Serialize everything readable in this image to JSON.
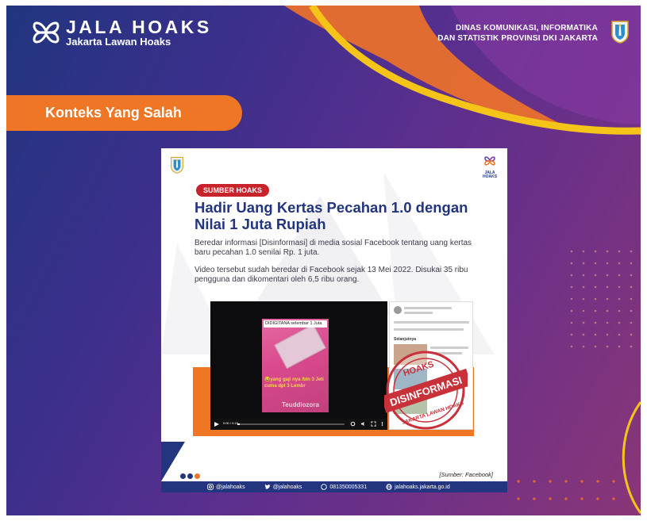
{
  "brand": {
    "title": "JALA HOAKS",
    "subtitle": "Jakarta Lawan Hoaks",
    "logo_icon": "jala-hoaks-logo-icon"
  },
  "agency": {
    "line1": "DINAS KOMUNIKASI, INFORMATIKA",
    "line2": "DAN STATISTIK PROVINSI DKI JAKARTA",
    "crest_icon": "dki-jakarta-crest-icon"
  },
  "category": "Konteks Yang Salah",
  "card": {
    "badge": "SUMBER HOAKS",
    "title": "Hadir Uang Kertas Pecahan 1.0 dengan Nilai 1 Juta Rupiah",
    "paragraph1": "Beredar informasi [Disinformasi] di media sosial Facebook tentang uang kertas baru pecahan 1.0 senilai Rp. 1 juta.",
    "paragraph2": "Video tersebut sudah beredar di Facebook sejak 13 Mei 2022. Disukai 35 ribu pengguna dan dikomentari oleh 6,5 ribu orang.",
    "logo_label": "JALA HOAKS",
    "source_note": "[Sumber: Facebook]"
  },
  "video": {
    "caption_top": "DIDIGITANA selembar 1 Juta",
    "caption_bottom": "😂yang gaji nya /bln 3 Jeti cuma dpt 3 Lembr",
    "watermark": "Teuddiozora",
    "time": "0:00 / 0:15",
    "progress": 0.02
  },
  "facebook_panel": {
    "next_label": "Selanjutnya"
  },
  "stamp": {
    "top_text": "HOAKS",
    "main_text": "DISINFORMASI",
    "bottom_text": "JAKARTA LAWAN HOAKS"
  },
  "footer": {
    "instagram": "@jalahoaks",
    "twitter": "@jalahoaks",
    "whatsapp": "081350005331",
    "website": "jalahoaks.jakarta.go.id"
  },
  "colors": {
    "accent_orange": "#ef7624",
    "navy": "#22357e",
    "badge_red": "#c8222b",
    "stamp_red": "#c8303a",
    "yellow_swoosh": "#f5c419"
  }
}
